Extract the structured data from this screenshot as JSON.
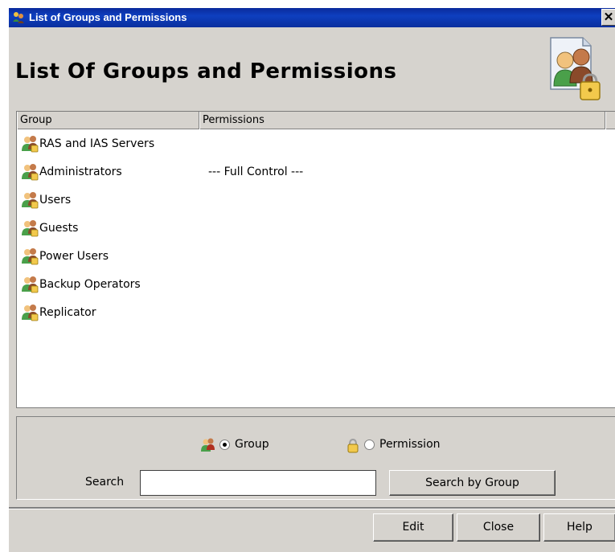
{
  "window": {
    "title": "List of Groups and Permissions",
    "close_glyph": "✕"
  },
  "header": {
    "title": "List Of Groups and Permissions",
    "icon": "groups-permissions-icon"
  },
  "list": {
    "columns": [
      "Group",
      "Permissions",
      ""
    ],
    "rows": [
      {
        "group": "RAS and IAS Servers",
        "permission": ""
      },
      {
        "group": "Administrators",
        "permission": "--- Full Control ---"
      },
      {
        "group": "Users",
        "permission": ""
      },
      {
        "group": "Guests",
        "permission": ""
      },
      {
        "group": "Power Users",
        "permission": ""
      },
      {
        "group": "Backup Operators",
        "permission": ""
      },
      {
        "group": "Replicator",
        "permission": ""
      }
    ]
  },
  "search": {
    "mode_options": [
      {
        "label": "Group",
        "selected": true,
        "icon": "group-icon"
      },
      {
        "label": "Permission",
        "selected": false,
        "icon": "lock-icon"
      }
    ],
    "search_label": "Search",
    "search_value": "",
    "search_button": "Search by Group"
  },
  "footer": {
    "edit": "Edit",
    "close": "Close",
    "help": "Help"
  }
}
